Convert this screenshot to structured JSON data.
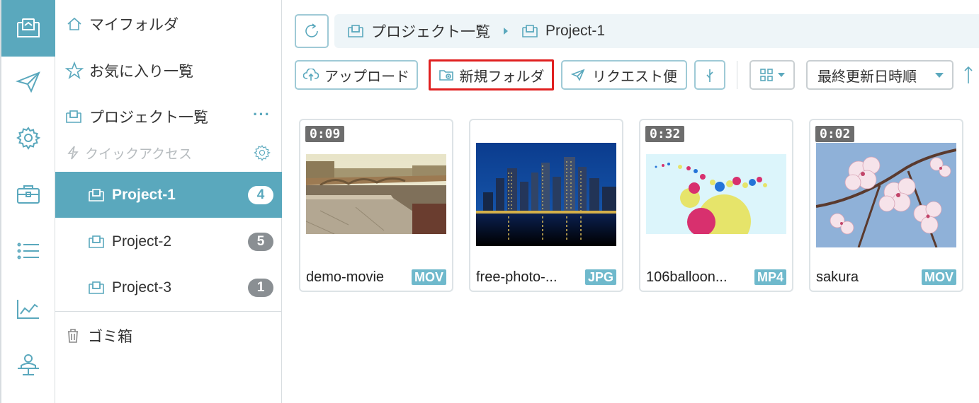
{
  "rail": {
    "items": [
      {
        "name": "folder-tray-icon",
        "active": true
      },
      {
        "name": "send-icon",
        "active": false
      },
      {
        "name": "gear-icon",
        "active": false
      },
      {
        "name": "briefcase-icon",
        "active": false
      },
      {
        "name": "list-icon",
        "active": false
      },
      {
        "name": "chart-icon",
        "active": false
      },
      {
        "name": "admin-user-icon",
        "active": false
      }
    ]
  },
  "sidebar": {
    "my_folder": "マイフォルダ",
    "favorites": "お気に入り一覧",
    "projects": "プロジェクト一覧",
    "projects_more": "···",
    "quick_access": "クイックアクセス",
    "items": [
      {
        "label": "Project-1",
        "count": "4"
      },
      {
        "label": "Project-2",
        "count": "5"
      },
      {
        "label": "Project-3",
        "count": "1"
      }
    ],
    "trash": "ゴミ箱"
  },
  "breadcrumb": {
    "root": "プロジェクト一覧",
    "current": "Project-1"
  },
  "toolbar": {
    "upload": "アップロード",
    "new_folder": "新規フォルダ",
    "request": "リクエスト便",
    "sort_selected": "最終更新日時順"
  },
  "colors": {
    "accent": "#5aa8bd",
    "highlight_border": "#e02020",
    "badge_gray": "#8a8f93"
  },
  "files": [
    {
      "name": "demo-movie",
      "type": "MOV",
      "duration": "0:09"
    },
    {
      "name": "free-photo-...",
      "type": "JPG",
      "duration": ""
    },
    {
      "name": "106balloon...",
      "type": "MP4",
      "duration": "0:32"
    },
    {
      "name": "sakura",
      "type": "MOV",
      "duration": "0:02"
    }
  ]
}
